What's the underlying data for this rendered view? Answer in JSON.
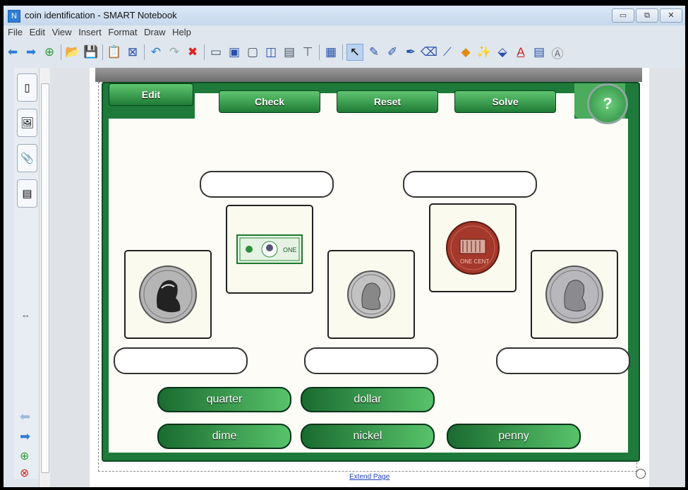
{
  "window": {
    "title": "coin identification - SMART Notebook",
    "controls": [
      "▭",
      "⧉",
      "✕"
    ]
  },
  "menu": [
    "File",
    "Edit",
    "View",
    "Insert",
    "Format",
    "Draw",
    "Help"
  ],
  "toolbar": {
    "icons": [
      "back-icon",
      "forward-icon",
      "add-page-icon",
      "open-icon",
      "save-icon",
      "paste-icon",
      "delete-page-icon",
      "undo-icon",
      "redo-icon",
      "delete-icon",
      "screen-shade-icon",
      "full-screen-icon",
      "transparent-bg-icon",
      "dual-page-icon",
      "capture-icon",
      "document-camera-icon",
      "table-icon",
      "select-icon",
      "pen-icon",
      "creative-pen-icon",
      "highlighter-icon",
      "eraser-icon",
      "line-icon",
      "shape-icon",
      "magic-pen-icon",
      "fill-icon",
      "text-icon",
      "properties-icon",
      "more-icon"
    ]
  },
  "sidebar": {
    "tabs": [
      "page-sorter",
      "gallery",
      "attachments",
      "properties"
    ],
    "resize_glyph": "↔"
  },
  "activity": {
    "edit_label": "Edit",
    "check_label": "Check",
    "reset_label": "Reset",
    "solve_label": "Solve",
    "help_label": "?",
    "items": [
      "nickel",
      "dollar bill",
      "dime",
      "penny",
      "quarter"
    ],
    "words": [
      "quarter",
      "dollar",
      "dime",
      "nickel",
      "penny"
    ],
    "bill_text": "ONE",
    "penny_text": "ONE CENT"
  },
  "footer": {
    "extend_page": "Extend Page"
  },
  "colors": {
    "frame_green": "#1e7a3a",
    "button_green": "#3fa351",
    "card_bg": "#fbfaee"
  }
}
